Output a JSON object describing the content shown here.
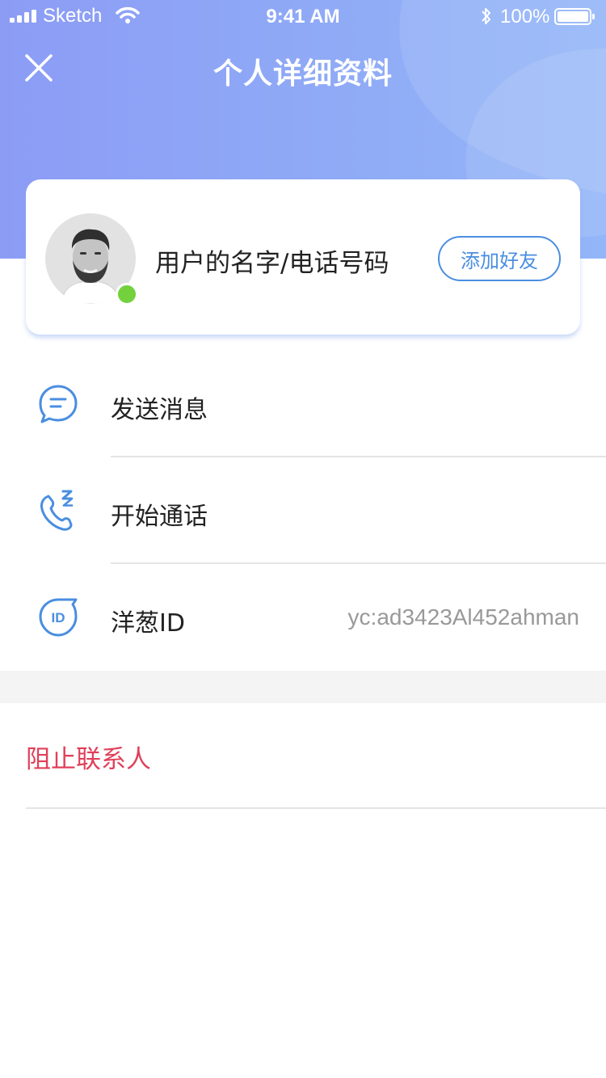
{
  "status_bar": {
    "carrier": "Sketch",
    "time": "9:41 AM",
    "battery": "100%"
  },
  "nav": {
    "title": "个人详细资料",
    "close_icon": "close-icon"
  },
  "profile": {
    "name": "用户的名字/电话号码",
    "add_friend_label": "添加好友",
    "online": true,
    "online_color": "#73d13d"
  },
  "menu": [
    {
      "icon": "message-icon",
      "label": "发送消息"
    },
    {
      "icon": "phone-call-icon",
      "label": "开始通话"
    },
    {
      "icon": "id-icon",
      "label": "洋葱ID",
      "value": "yc:ad3423Al452ahman"
    }
  ],
  "block_contact": {
    "label": "阻止联系人",
    "color": "#e0405a"
  },
  "colors": {
    "accent": "#4a8ee0",
    "header_gradient_start": "#8c9cf5",
    "header_gradient_end": "#93b6f8"
  }
}
